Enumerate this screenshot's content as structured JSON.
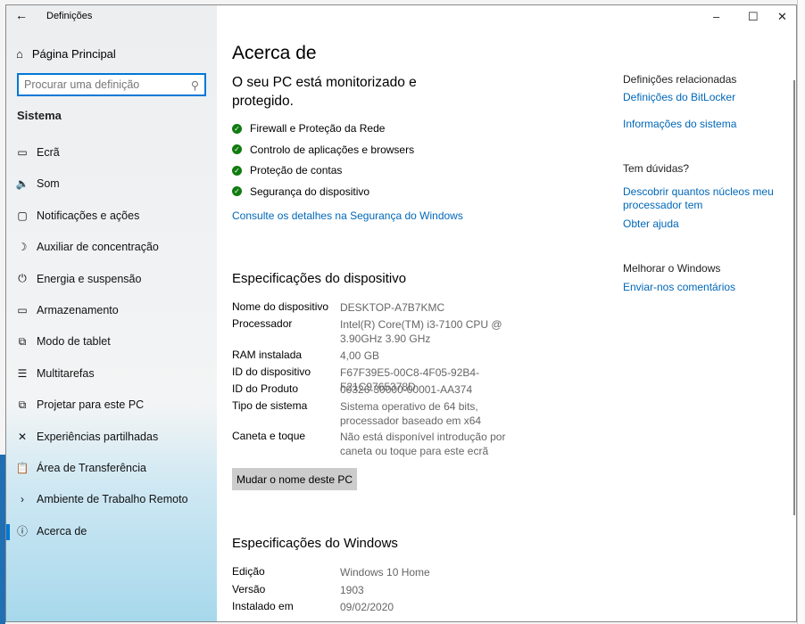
{
  "window": {
    "title": "Definições",
    "back": "←",
    "minimize": "–",
    "maximize": "☐",
    "close": "✕"
  },
  "sidebar": {
    "home": "Página Principal",
    "search_placeholder": "Procurar uma definição",
    "section": "Sistema",
    "items": [
      {
        "icon": "▭",
        "label": "Ecrã"
      },
      {
        "icon": "🔈",
        "label": "Som"
      },
      {
        "icon": "▢",
        "label": "Notificações e ações"
      },
      {
        "icon": "☽",
        "label": "Auxiliar de concentração"
      },
      {
        "icon": "⏻",
        "label": "Energia e suspensão"
      },
      {
        "icon": "▭",
        "label": "Armazenamento"
      },
      {
        "icon": "⧉",
        "label": "Modo de tablet"
      },
      {
        "icon": "☰",
        "label": "Multitarefas"
      },
      {
        "icon": "⧉",
        "label": "Projetar para este PC"
      },
      {
        "icon": "✕",
        "label": "Experiências partilhadas"
      },
      {
        "icon": "📋",
        "label": "Área de Transferência"
      },
      {
        "icon": "›",
        "label": "Ambiente de Trabalho Remoto"
      },
      {
        "icon": "ⓘ",
        "label": "Acerca de"
      }
    ]
  },
  "main": {
    "title": "Acerca de",
    "protection": "O seu PC está monitorizado e protegido.",
    "checks": [
      "Firewall e Proteção da Rede",
      "Controlo de aplicações e browsers",
      "Proteção de contas",
      "Segurança do dispositivo"
    ],
    "security_link": "Consulte os detalhes na Segurança do Windows",
    "device_title": "Especificações do dispositivo",
    "device": [
      {
        "k": "Nome do dispositivo",
        "v": "DESKTOP-A7B7KMC"
      },
      {
        "k": "Processador",
        "v": "Intel(R) Core(TM) i3-7100 CPU @ 3.90GHz 3.90 GHz"
      },
      {
        "k": "RAM instalada",
        "v": "4,00 GB"
      },
      {
        "k": "ID do dispositivo",
        "v": "F67F39E5-00C8-4F05-92B4-F21C9765378D"
      },
      {
        "k": "ID do Produto",
        "v": "00326-30000-00001-AA374"
      },
      {
        "k": "Tipo de sistema",
        "v": "Sistema operativo de 64 bits, processador baseado em x64"
      },
      {
        "k": "Caneta e toque",
        "v": "Não está disponível introdução por caneta ou toque para este ecrã"
      }
    ],
    "rename_button": "Mudar o nome deste PC",
    "windows_title": "Especificações do Windows",
    "windows": [
      {
        "k": "Edição",
        "v": "Windows 10 Home"
      },
      {
        "k": "Versão",
        "v": "1903"
      },
      {
        "k": "Instalado em",
        "v": "09/02/2020"
      }
    ]
  },
  "related": {
    "title": "Definições relacionadas",
    "links": [
      "Definições do BitLocker",
      "Informações do sistema"
    ],
    "questions_title": "Tem dúvidas?",
    "q_links": [
      "Descobrir quantos núcleos meu processador tem",
      "Obter ajuda"
    ],
    "improve_title": "Melhorar o Windows",
    "improve_link": "Enviar-nos comentários"
  }
}
